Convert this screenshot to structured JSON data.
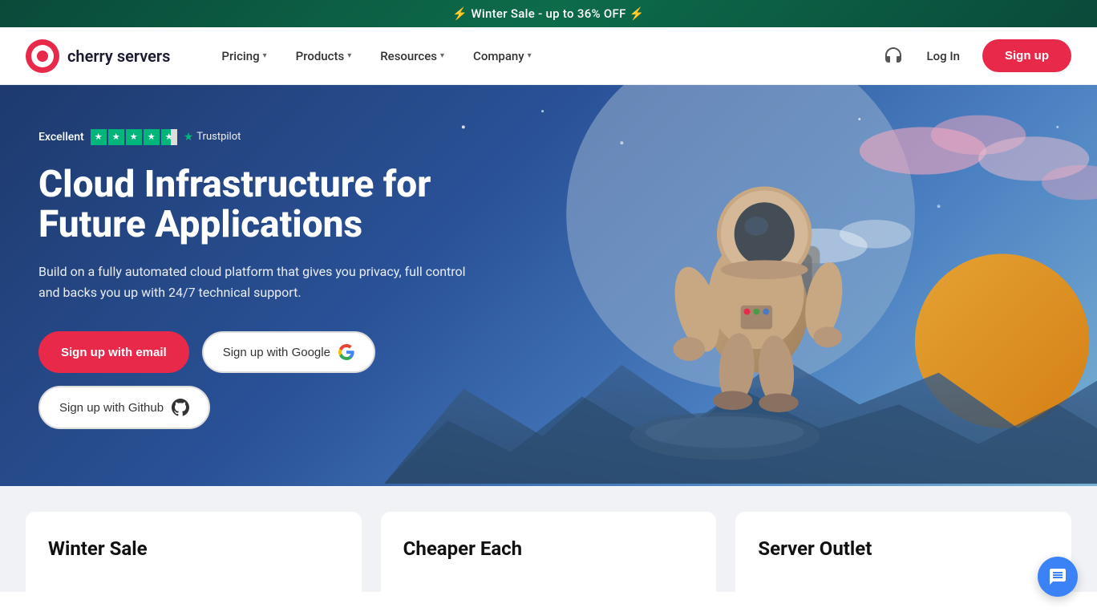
{
  "banner": {
    "text": "⚡ Winter Sale - up to 36% OFF ⚡"
  },
  "nav": {
    "logo_text": "cherry servers",
    "pricing_label": "Pricing",
    "products_label": "Products",
    "resources_label": "Resources",
    "company_label": "Company",
    "login_label": "Log In",
    "signup_label": "Sign up"
  },
  "hero": {
    "trustpilot_label": "Excellent",
    "trustpilot_brand": "Trustpilot",
    "title": "Cloud Infrastructure for Future Applications",
    "subtitle": "Build on a fully automated cloud platform that gives you privacy, full control and backs you up with 24/7 technical support.",
    "btn_email": "Sign up with email",
    "btn_google": "Sign up with Google",
    "btn_github": "Sign up with Github"
  },
  "bottom_cards": {
    "card1_title": "Winter Sale",
    "card2_title": "Cheaper Each",
    "card3_title": "Server Outlet"
  },
  "colors": {
    "accent": "#e8294a",
    "nav_bg": "#ffffff",
    "hero_bg_start": "#1e3a6e",
    "hero_bg_end": "#4a7fc1",
    "trustpilot_green": "#00b67a"
  }
}
